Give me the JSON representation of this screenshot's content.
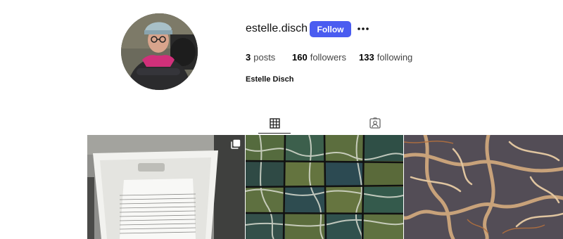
{
  "profile": {
    "username": "estelle.disch",
    "follow_label": "Follow",
    "more_icon": "more-dots-icon",
    "full_name": "Estelle Disch"
  },
  "stats": {
    "posts_count": "3",
    "posts_label": "posts",
    "followers_count": "160",
    "followers_label": "followers",
    "following_count": "133",
    "following_label": "following"
  },
  "tabs": [
    {
      "icon": "grid-icon",
      "selected": true
    },
    {
      "icon": "tagged-user-icon",
      "selected": false
    }
  ],
  "colors": {
    "accent": "#4a5cf0",
    "text_primary": "#000000",
    "text_secondary": "#444444"
  },
  "posts": [
    {
      "subject": "white crate of stacked papers",
      "icon": "multiple-images-icon"
    },
    {
      "subject": "green and white marble tiles"
    },
    {
      "subject": "tan and brown tree roots pattern"
    }
  ]
}
